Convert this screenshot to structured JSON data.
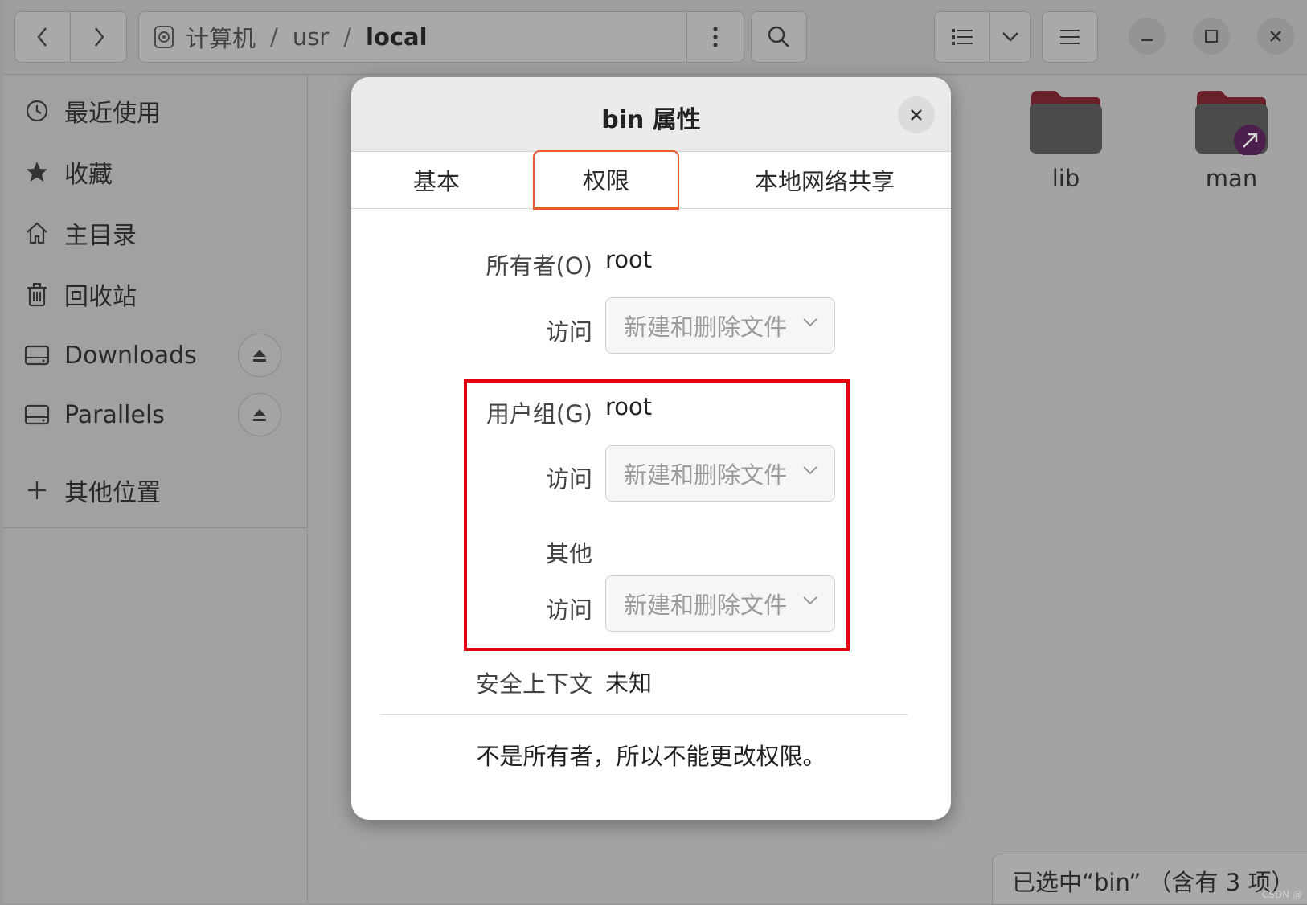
{
  "window": {
    "breadcrumb": [
      "计算机",
      "usr",
      "local"
    ],
    "breadcrumb_sep": "/"
  },
  "sidebar": {
    "items": [
      {
        "label": "最近使用",
        "icon": "clock-icon"
      },
      {
        "label": "收藏",
        "icon": "star-icon"
      },
      {
        "label": "主目录",
        "icon": "home-icon"
      },
      {
        "label": "回收站",
        "icon": "trash-icon"
      },
      {
        "label": "Downloads",
        "icon": "drive-icon",
        "eject": true
      },
      {
        "label": "Parallels",
        "icon": "drive-icon",
        "eject": true
      }
    ],
    "other_locations": "其他位置"
  },
  "content": {
    "folders": [
      {
        "name": "lib",
        "link": false
      },
      {
        "name": "man",
        "link": true
      }
    ],
    "status": "已选中“bin” （含有 3 项）",
    "watermark": "CSDN @"
  },
  "dialog": {
    "title": "bin 属性",
    "tabs": [
      "基本",
      "权限",
      "本地网络共享"
    ],
    "active_tab": "权限",
    "owner_label": "所有者(O)",
    "owner_value": "root",
    "owner_access_label": "访问",
    "owner_access": "新建和删除文件",
    "group_label": "用户组(G)",
    "group_value": "root",
    "group_access_label": "访问",
    "group_access": "新建和删除文件",
    "others_label": "其他",
    "others_access_label": "访问",
    "others_access": "新建和删除文件",
    "security_label": "安全上下文",
    "security_value": "未知",
    "note": "不是所有者，所以不能更改权限。"
  },
  "colors": {
    "accent": "#e8592f",
    "highlight_box": "#e4000f",
    "folder_dark": "#4b4b4b",
    "folder_tab": "#6a1f2a",
    "link_badge": "#4c1f4d"
  }
}
